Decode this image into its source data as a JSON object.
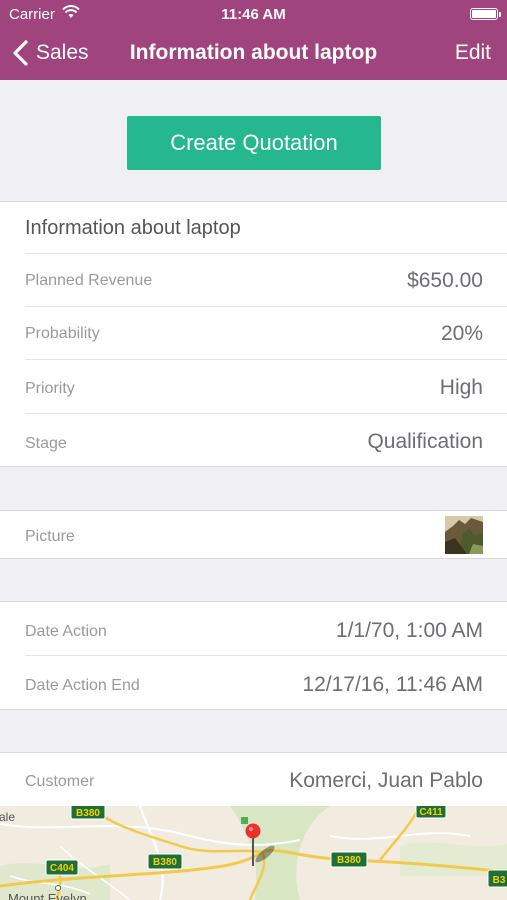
{
  "status_bar": {
    "carrier": "Carrier",
    "time": "11:46 AM"
  },
  "nav": {
    "back_label": "Sales",
    "title": "Information about laptop",
    "edit_label": "Edit"
  },
  "actions": {
    "create_quotation": "Create Quotation"
  },
  "details": {
    "section_title": "Information about laptop",
    "planned_revenue": {
      "label": "Planned Revenue",
      "value": "$650.00"
    },
    "probability": {
      "label": "Probability",
      "value": "20%"
    },
    "priority": {
      "label": "Priority",
      "value": "High"
    },
    "stage": {
      "label": "Stage",
      "value": "Qualification"
    }
  },
  "picture": {
    "label": "Picture"
  },
  "dates": {
    "date_action": {
      "label": "Date Action",
      "value": "1/1/70, 1:00 AM"
    },
    "date_action_end": {
      "label": "Date Action End",
      "value": "12/17/16, 11:46 AM"
    }
  },
  "customer": {
    "label": "Customer",
    "value": "Komerci, Juan Pablo"
  },
  "map": {
    "road_labels": [
      "B380",
      "C411",
      "C404",
      "B380",
      "B380",
      "B3"
    ],
    "place_labels": [
      "ale",
      "Mount Evelyn"
    ]
  },
  "colors": {
    "nav": "#a0447e",
    "button": "#25b88f",
    "pin": "#e8322b"
  }
}
